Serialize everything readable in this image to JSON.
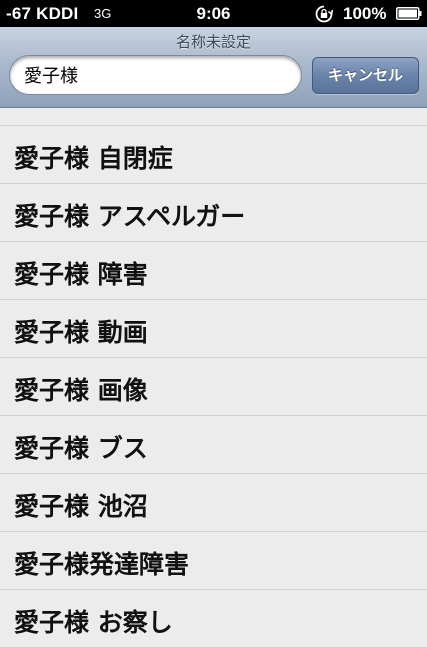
{
  "status_bar": {
    "carrier": "-67 KDDI",
    "network": "3G",
    "time": "9:06",
    "battery": "100%",
    "icons": [
      "rotation-lock-icon",
      "battery-icon"
    ]
  },
  "nav": {
    "title": "名称未設定",
    "search_value": "愛子様",
    "cancel_label": "キャンセル"
  },
  "suggestions": [
    "愛子様 自閉症",
    "愛子様 アスペルガー",
    "愛子様 障害",
    "愛子様 動画",
    "愛子様 画像",
    "愛子様 ブス",
    "愛子様 池沼",
    "愛子様発達障害",
    "愛子様 お察し"
  ]
}
